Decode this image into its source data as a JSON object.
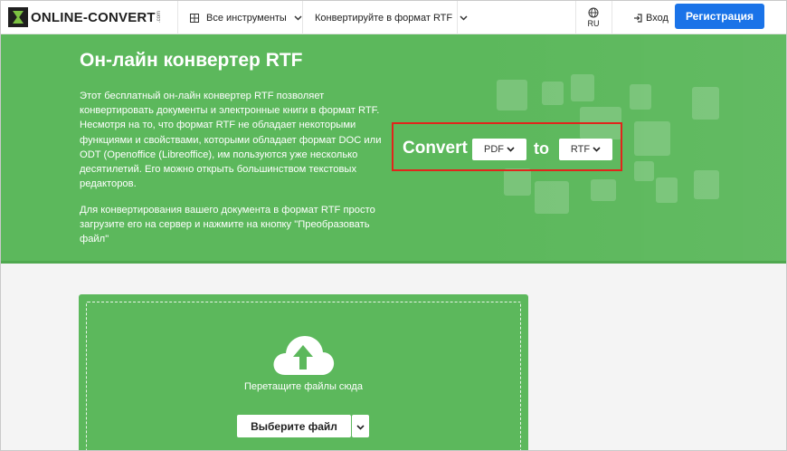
{
  "header": {
    "logo_text": "ONLINE-CONVERT",
    "logo_com": ".com",
    "all_tools_label": "Все инструменты",
    "convert_to_label": "Конвертируйте в формат RTF",
    "language": "RU",
    "login_label": "Вход",
    "register_label": "Регистрация"
  },
  "hero": {
    "title": "Он-лайн конвертер RTF",
    "paragraph1": "Этот бесплатный он-лайн конвертер RTF позволяет конвертировать документы и электронные книги в формат RTF. Несмотря на то, что формат RTF не обладает некоторыми функциями и свойствами, которыми обладает формат DOC или ODT (Openoffice (Libreoffice), им пользуются уже несколько десятилетий. Его можно открыть большинством текстовых редакторов.",
    "paragraph2": "Для конвертирования вашего документа в формат RTF просто загрузите его на сервер и нажмите на кнопку \"Преобразовать файл\""
  },
  "converter": {
    "convert_label": "Convert",
    "from_format": "PDF",
    "to_label": "to",
    "to_format": "RTF"
  },
  "upload": {
    "drop_text": "Перетащите файлы сюда",
    "choose_file_label": "Выберите файл"
  },
  "colors": {
    "brand_green": "#5cb85c",
    "primary_blue": "#1a73e8",
    "highlight_red": "#e1251b"
  },
  "icons": [
    "grid-icon",
    "chevron-down-icon",
    "globe-icon",
    "login-icon",
    "cloud-upload-icon"
  ]
}
